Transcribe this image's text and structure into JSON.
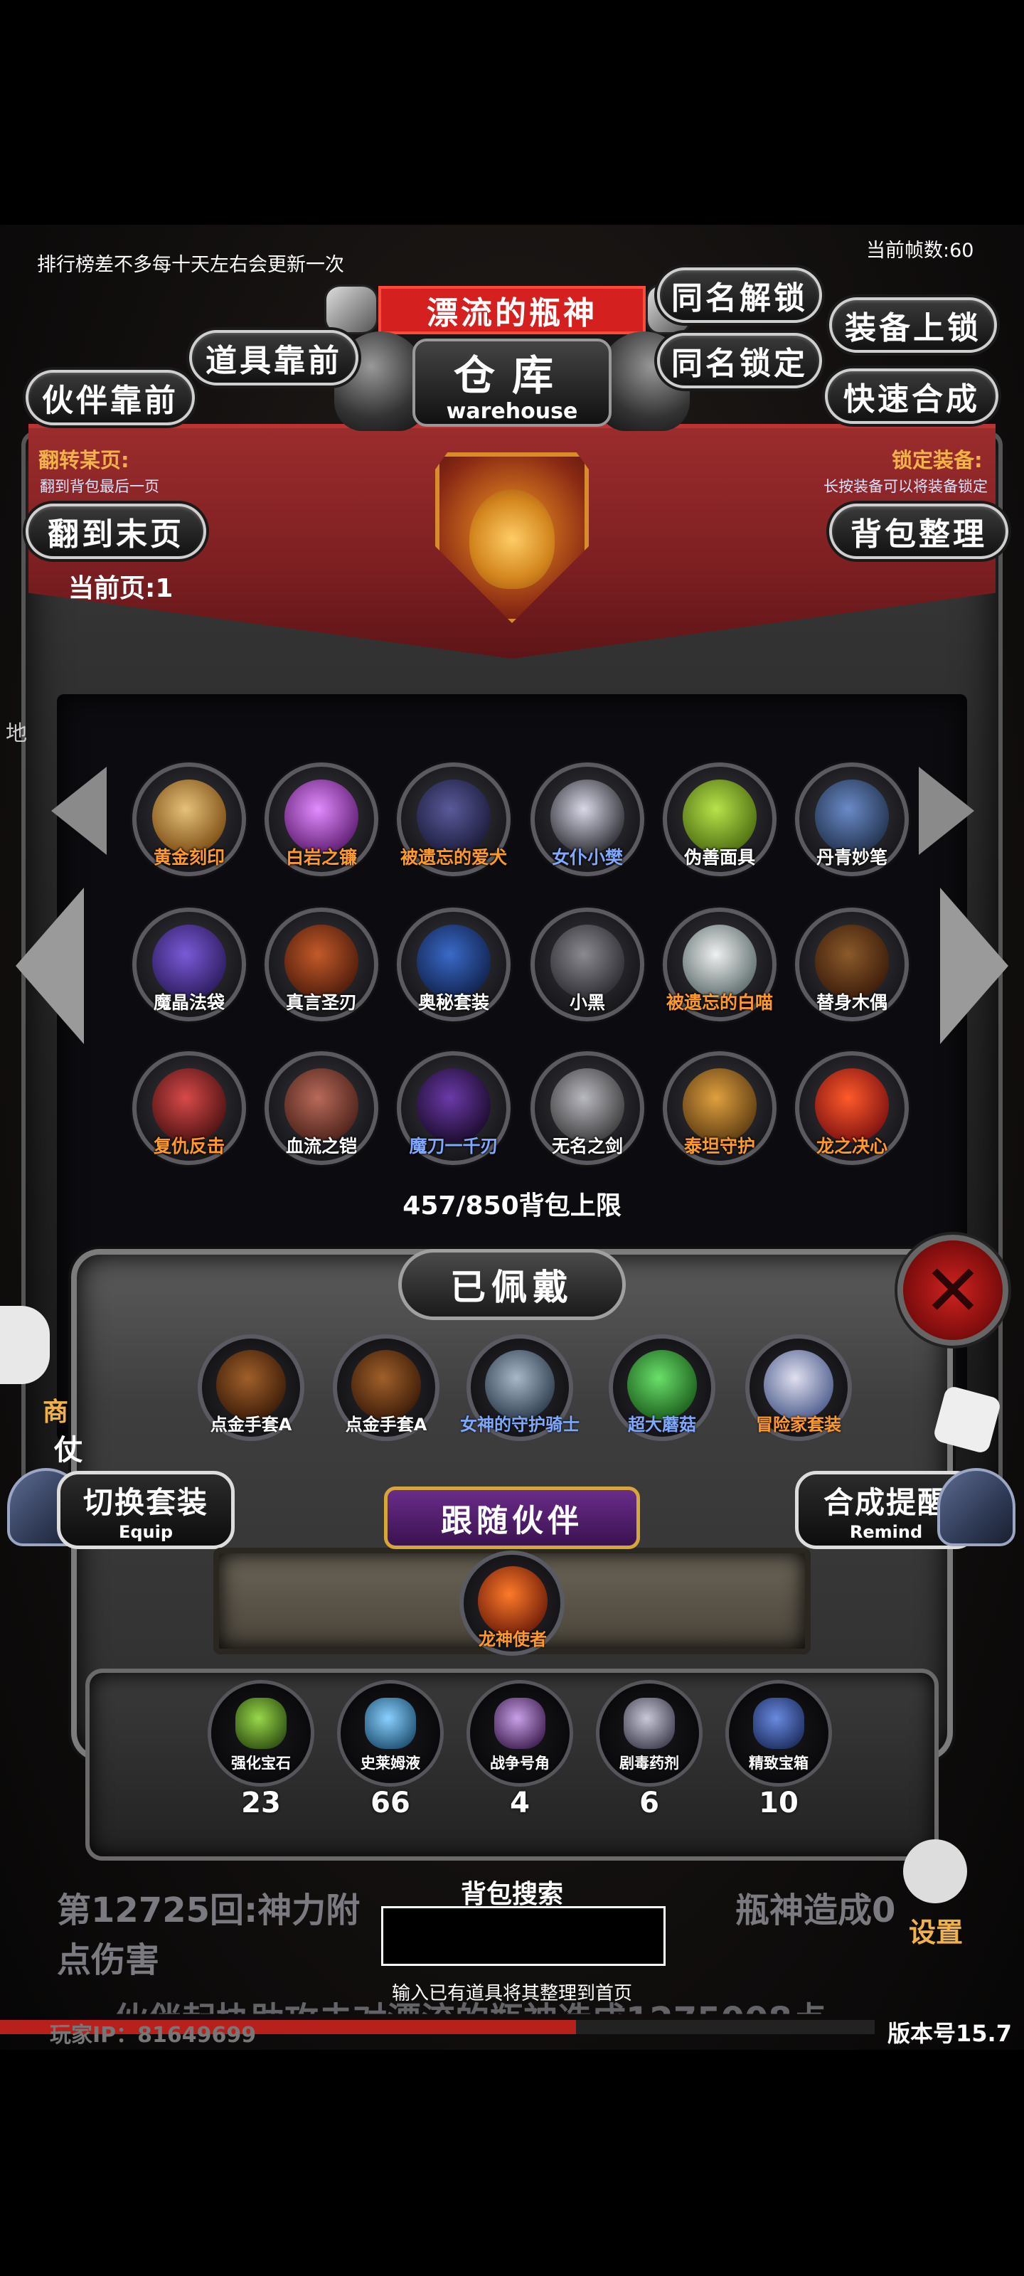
{
  "top": {
    "notice": "排行榜差不多每十天左右会更新一次",
    "fps": "当前帧数:60",
    "boss_name": "漂流的瓶神",
    "warehouse_title": "仓库",
    "warehouse_sub": "warehouse"
  },
  "buttons": {
    "same_name_unlock": "同名解锁",
    "same_name_lock": "同名锁定",
    "equip_lock": "装备上锁",
    "quick_craft": "快速合成",
    "items_front": "道具靠前",
    "partner_front": "伙伴靠前",
    "goto_last": "翻到末页",
    "bag_sort": "背包整理"
  },
  "labels": {
    "flip_page": "翻转某页:",
    "flip_page_sub": "翻到背包最后一页",
    "lock_equip": "锁定装备:",
    "lock_equip_sub": "长按装备可以将装备锁定",
    "current_page": "当前页:1",
    "capacity": "457/850背包上限",
    "side_char": "地"
  },
  "inventory": {
    "items": [
      {
        "name": "黄金刻印",
        "color": "#ff9a2a",
        "icon": "gold-seal-icon",
        "c1": "#e6c27a",
        "c2": "#7a4b12"
      },
      {
        "name": "白岩之镰",
        "color": "#ff9a2a",
        "icon": "scythe-icon",
        "c1": "#e38cff",
        "c2": "#5b1a6e"
      },
      {
        "name": "被遗忘的爱犬",
        "color": "#ff9a2a",
        "icon": "wolf-icon",
        "c1": "#5a5a9a",
        "c2": "#1a1a3a"
      },
      {
        "name": "女仆小樊",
        "color": "#7fa8ff",
        "icon": "maid-icon",
        "c1": "#d8d8e8",
        "c2": "#2a2a30"
      },
      {
        "name": "伪善面具",
        "color": "#ffffff",
        "icon": "mask-icon",
        "c1": "#b8e34a",
        "c2": "#4a6a10"
      },
      {
        "name": "丹青妙笔",
        "color": "#ffffff",
        "icon": "brush-icon",
        "c1": "#6a8ac8",
        "c2": "#20304a"
      },
      {
        "name": "魔晶法袋",
        "color": "#ffffff",
        "icon": "mage-icon",
        "c1": "#7a5ad8",
        "c2": "#2a1a5a"
      },
      {
        "name": "真言圣刃",
        "color": "#ffffff",
        "icon": "sword-icon",
        "c1": "#c45a2a",
        "c2": "#4a1a0a"
      },
      {
        "name": "奥秘套装",
        "color": "#ffffff",
        "icon": "robe-icon",
        "c1": "#3a6ac8",
        "c2": "#10204a"
      },
      {
        "name": "小黑",
        "color": "#ffffff",
        "icon": "dolphin-icon",
        "c1": "#8a8a90",
        "c2": "#2a2a30"
      },
      {
        "name": "被遗忘的白喵",
        "color": "#ff9a2a",
        "icon": "cat-icon",
        "c1": "#f0f0f0",
        "c2": "#5a6a6a"
      },
      {
        "name": "替身木偶",
        "color": "#ffffff",
        "icon": "puppet-icon",
        "c1": "#8a5a2a",
        "c2": "#3a1a0a"
      },
      {
        "name": "复仇反击",
        "color": "#ff9a2a",
        "icon": "revenge-icon",
        "c1": "#d84a4a",
        "c2": "#4a1010"
      },
      {
        "name": "血流之铠",
        "color": "#ffffff",
        "icon": "armor-icon",
        "c1": "#b86a5a",
        "c2": "#4a2018"
      },
      {
        "name": "魔刀一千刃",
        "color": "#7fa8ff",
        "icon": "katana-icon",
        "c1": "#6a3aa8",
        "c2": "#1a0a2a"
      },
      {
        "name": "无名之剑",
        "color": "#ffffff",
        "icon": "blade-icon",
        "c1": "#b8b8c0",
        "c2": "#3a3a3a"
      },
      {
        "name": "泰坦守护",
        "color": "#ff9a2a",
        "icon": "titan-icon",
        "c1": "#e0a040",
        "c2": "#5a3a10"
      },
      {
        "name": "龙之决心",
        "color": "#ff9a2a",
        "icon": "dragon-flame-icon",
        "c1": "#ff5a2a",
        "c2": "#7a1010"
      }
    ]
  },
  "equipped": {
    "title": "已佩戴",
    "items": [
      {
        "name": "点金手套A",
        "color": "#ffffff",
        "icon": "gauntlet-icon",
        "c1": "#a0602a",
        "c2": "#3a1a08"
      },
      {
        "name": "点金手套A",
        "color": "#ffffff",
        "icon": "gauntlet-icon",
        "c1": "#a0602a",
        "c2": "#3a1a08"
      },
      {
        "name": "女神的守护骑士",
        "color": "#7fa8ff",
        "icon": "knight-icon",
        "c1": "#a8b8c8",
        "c2": "#2a3a4a"
      },
      {
        "name": "超大蘑菇",
        "color": "#7fa8ff",
        "icon": "mushroom-icon",
        "c1": "#6ae06a",
        "c2": "#1a5a1a"
      },
      {
        "name": "冒险家套装",
        "color": "#ff9a2a",
        "icon": "adventurer-icon",
        "c1": "#e0e0f0",
        "c2": "#4a5a8a"
      }
    ]
  },
  "switch_set": {
    "main": "切换套装",
    "sub": "Equip"
  },
  "craft_remind": {
    "main": "合成提醒",
    "sub": "Remind"
  },
  "follow": {
    "title": "跟随伙伴",
    "partner": {
      "name": "龙神使者",
      "color": "#ff9a2a",
      "icon": "dragon-envoy-icon",
      "c1": "#ff7a2a",
      "c2": "#6a1a08"
    }
  },
  "materials": [
    {
      "name": "强化宝石",
      "count": "23",
      "icon": "gem-icon",
      "c1": "#9ad84a",
      "c2": "#2a4a10"
    },
    {
      "name": "史莱姆液",
      "count": "66",
      "icon": "potion-icon",
      "c1": "#8ad0ff",
      "c2": "#1a4a6a"
    },
    {
      "name": "战争号角",
      "count": "4",
      "icon": "horn-icon",
      "c1": "#c8a0e8",
      "c2": "#3a1a4a"
    },
    {
      "name": "剧毒药剂",
      "count": "6",
      "icon": "poison-icon",
      "c1": "#c8c8d8",
      "c2": "#3a3a4a"
    },
    {
      "name": "精致宝箱",
      "count": "10",
      "icon": "chest-icon",
      "c1": "#6a8ae0",
      "c2": "#1a2a5a"
    }
  ],
  "bottom": {
    "log_line1_a": "第12725回:神力附",
    "log_line1_b": "瓶神造成0",
    "log_line2": "点伤害",
    "log_line3": "伙伴起协助攻击对漂流的瓶神造成1275008点",
    "search_title": "背包搜索",
    "search_value": "",
    "search_hint": "输入已有道具将其整理到首页",
    "player_ip": "玩家IP：81649699",
    "version": "版本号15.7",
    "settings": "设置",
    "shop_char": "商",
    "shop_char2": "仗"
  }
}
